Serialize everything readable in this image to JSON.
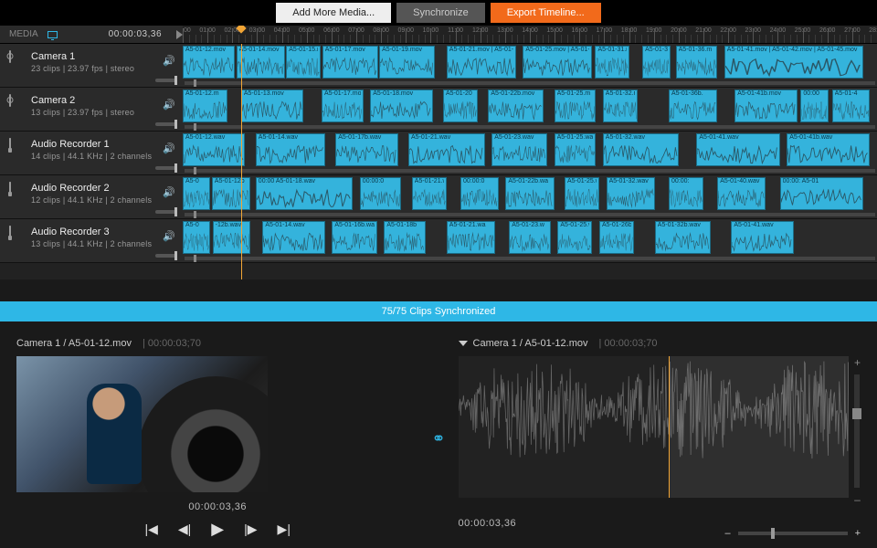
{
  "toolbar": {
    "add_media": "Add More Media...",
    "synchronize": "Synchronize",
    "export": "Export Timeline..."
  },
  "header": {
    "label": "MEDIA",
    "timecode": "00:00:03,36"
  },
  "ruler": {
    "labels": [
      "00:00",
      "01:00",
      "02:00",
      "03:00",
      "04:00",
      "05:00",
      "06:00",
      "07:00",
      "08:00",
      "09:00",
      "10:00",
      "11:00",
      "12:00",
      "13:00",
      "14:00",
      "15:00",
      "16:00",
      "17:00",
      "18:00",
      "19:00",
      "20:00",
      "21:00",
      "22:00",
      "23:00",
      "24:00",
      "25:00",
      "26:00",
      "27:00",
      "28:00"
    ]
  },
  "playhead_pct": 8.4,
  "tracks": [
    {
      "kind": "camera",
      "name": "Camera 1",
      "meta": "23 clips  |  23.97 fps  |  stereo",
      "clips": [
        {
          "l": 0,
          "w": 7.5,
          "lbl": "A5-01-12.mov"
        },
        {
          "l": 7.7,
          "w": 7.0,
          "lbl": "A5-01-14.mov"
        },
        {
          "l": 14.9,
          "w": 5.0,
          "lbl": "A5-01-15.r"
        },
        {
          "l": 20.1,
          "w": 8.0,
          "lbl": "A5-01-17.mov"
        },
        {
          "l": 28.3,
          "w": 8.0,
          "lbl": "A5-01-19.mov"
        },
        {
          "l": 38.0,
          "w": 10.0,
          "lbl": "A5-01-21.mov | A5-01-22.mov"
        },
        {
          "l": 49.0,
          "w": 10.0,
          "lbl": "A5-01-25.mov | A5-01-2"
        },
        {
          "l": 59.4,
          "w": 5.0,
          "lbl": "A5-01-31.m"
        },
        {
          "l": 66.2,
          "w": 4.0,
          "lbl": "A5-01-33.r"
        },
        {
          "l": 71.0,
          "w": 6.0,
          "lbl": "A5-01-36.m"
        },
        {
          "l": 78.0,
          "w": 20.0,
          "lbl": "A5-01-41.mov | A5-01-42.mov | A5-01-45.mov"
        }
      ]
    },
    {
      "kind": "camera",
      "name": "Camera 2",
      "meta": "13 clips  |  23.97 fps  |  stereo",
      "clips": [
        {
          "l": 0,
          "w": 6.5,
          "lbl": "A5-01-12.m"
        },
        {
          "l": 8.4,
          "w": 9.0,
          "lbl": "A5-01-13.mov"
        },
        {
          "l": 20.0,
          "w": 6.0,
          "lbl": "A5-01-17.mov"
        },
        {
          "l": 27.0,
          "w": 9.0,
          "lbl": "A5-01-18.mov"
        },
        {
          "l": 37.5,
          "w": 5.0,
          "lbl": "A5-01-20"
        },
        {
          "l": 44.0,
          "w": 8.0,
          "lbl": "A5-01-22b.mov"
        },
        {
          "l": 53.5,
          "w": 6.0,
          "lbl": "A5-01-25.m"
        },
        {
          "l": 60.5,
          "w": 5.0,
          "lbl": "A5-01-32.m"
        },
        {
          "l": 70.0,
          "w": 7.0,
          "lbl": "A5-01-36b."
        },
        {
          "l": 79.5,
          "w": 9.0,
          "lbl": "A5-01-41b.mov"
        },
        {
          "l": 89.0,
          "w": 4.0,
          "lbl": "00:00"
        },
        {
          "l": 93.5,
          "w": 5.5,
          "lbl": "A5-01-4"
        }
      ]
    },
    {
      "kind": "audio",
      "name": "Audio Recorder 1",
      "meta": "14 clips  |  44.1 KHz  |  2 channels",
      "clips": [
        {
          "l": 0,
          "w": 9.0,
          "lbl": "A5-01-12.wav"
        },
        {
          "l": 10.5,
          "w": 10.0,
          "lbl": "A5-01-14.wav"
        },
        {
          "l": 22.0,
          "w": 9.0,
          "lbl": "A5-01-17b.wav"
        },
        {
          "l": 32.5,
          "w": 11.0,
          "lbl": "A5-01-21.wav"
        },
        {
          "l": 44.5,
          "w": 8.0,
          "lbl": "A5-01-23.wav"
        },
        {
          "l": 53.5,
          "w": 6.0,
          "lbl": "A5-01-25.wav"
        },
        {
          "l": 60.5,
          "w": 11.0,
          "lbl": "A5-01-32.wav"
        },
        {
          "l": 74.0,
          "w": 12.0,
          "lbl": "A5-01-41.wav"
        },
        {
          "l": 87.0,
          "w": 12.0,
          "lbl": "A5-01-41b.wav"
        }
      ]
    },
    {
      "kind": "audio",
      "name": "Audio Recorder 2",
      "meta": "12 clips  |  44.1 KHz  |  2 channels",
      "clips": [
        {
          "l": 0,
          "w": 4.0,
          "lbl": "A5-0"
        },
        {
          "l": 4.2,
          "w": 5.5,
          "lbl": "A5-01-12b"
        },
        {
          "l": 10.5,
          "w": 14.0,
          "lbl": "00:00  A5-01-18.wav"
        },
        {
          "l": 25.5,
          "w": 6.0,
          "lbl": "00:00:0"
        },
        {
          "l": 33.0,
          "w": 5.0,
          "lbl": "A5-01-21.wa"
        },
        {
          "l": 40.0,
          "w": 5.5,
          "lbl": "00:00:0"
        },
        {
          "l": 46.5,
          "w": 7.0,
          "lbl": "A5-01-22b.wa"
        },
        {
          "l": 55.0,
          "w": 5.0,
          "lbl": "A5-01-25.w"
        },
        {
          "l": 61.0,
          "w": 7.0,
          "lbl": "A5-01-32.wav"
        },
        {
          "l": 70.0,
          "w": 5.0,
          "lbl": "00:00:"
        },
        {
          "l": 77.0,
          "w": 7.0,
          "lbl": "A5-01-40.wav"
        },
        {
          "l": 86.0,
          "w": 12.0,
          "lbl": "00:00:  A5-01"
        }
      ]
    },
    {
      "kind": "audio",
      "name": "Audio Recorder 3",
      "meta": "13 clips  |  44.1 KHz  |  2 channels",
      "clips": [
        {
          "l": 0,
          "w": 4.0,
          "lbl": "A5-0"
        },
        {
          "l": 4.3,
          "w": 5.5,
          "lbl": "-12b.wav"
        },
        {
          "l": 11.5,
          "w": 9.0,
          "lbl": "A5-01-14.wav"
        },
        {
          "l": 21.5,
          "w": 6.5,
          "lbl": "A5-01-16b.wav"
        },
        {
          "l": 29.0,
          "w": 6.0,
          "lbl": "A5-01-18b"
        },
        {
          "l": 38.0,
          "w": 7.0,
          "lbl": "A5-01-21.wa"
        },
        {
          "l": 47.0,
          "w": 6.0,
          "lbl": "A5-01-23.w"
        },
        {
          "l": 54.0,
          "w": 5.0,
          "lbl": "A5-01-25.w"
        },
        {
          "l": 60.0,
          "w": 5.0,
          "lbl": "A5-01-26b."
        },
        {
          "l": 68.0,
          "w": 8.0,
          "lbl": "A5-01-32b.wav"
        },
        {
          "l": 79.0,
          "w": 9.0,
          "lbl": "A5-01-41.wav"
        }
      ]
    }
  ],
  "sync_status": "75/75  Clips Synchronized",
  "preview": {
    "left_title": "Camera 1 / A5-01-12.mov ",
    "left_tc": "|  00:00:03;70",
    "right_title": "Camera 1 / A5-01-12.mov ",
    "right_tc": "|  00:00:03;70",
    "big_tc": "00:00:03,36",
    "zoom_minus": "–",
    "zoom_plus": "+"
  }
}
